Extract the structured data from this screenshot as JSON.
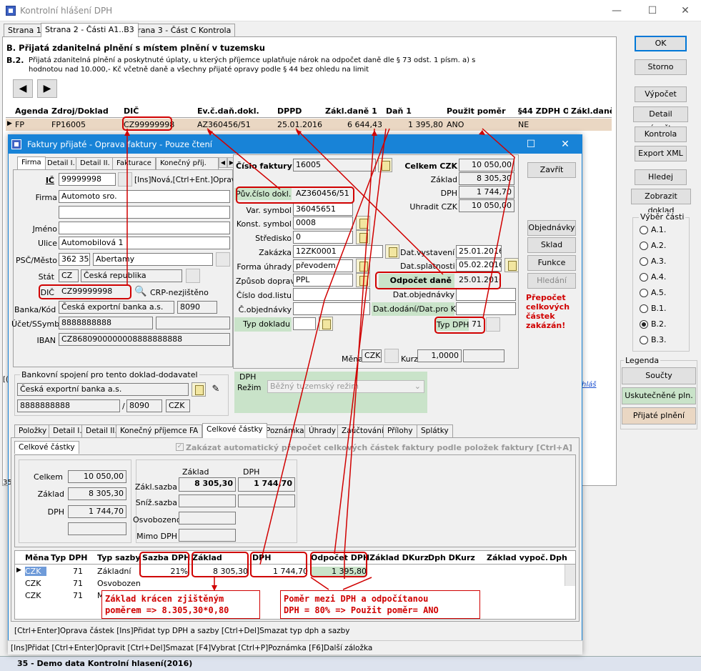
{
  "main_window": {
    "title": "Kontrolní hlášení DPH",
    "minimize": "—",
    "maximize": "☐",
    "close": "✕",
    "tabs": [
      "Strana 1",
      "Strana 2 - Části A1..B3",
      "Strana 3 - Část C Kontrola"
    ],
    "section_title": "B. Přijatá zdanitelná plnění s místem plnění v tuzemsku",
    "section_code": "B.2.",
    "section_desc1": "Přijatá zdanitelná plnění a poskytnuté úplaty, u kterých příjemce uplatňuje nárok na odpočet daně dle § 73 odst. 1 písm. a) s",
    "section_desc2": "hodnotou nad 10.000,- Kč včetně daně a všechny přijaté opravy podle § 44 bez ohledu na limit",
    "nav_prev": "◀",
    "nav_next": "▶",
    "grid": {
      "headers": [
        "Agenda",
        "Zdroj/Doklad",
        "DIČ",
        "Ev.č.daň.dokl.",
        "DPPD",
        "Zákl.daně 1",
        "Daň 1",
        "Použit poměr",
        "§44 ZDPH O",
        "Zákl.daně"
      ],
      "row": [
        "FP",
        "FP16005",
        "CZ99999998",
        "AZ360456/51",
        "25.01.2016",
        "6 644,43",
        "1 395,80",
        "ANO",
        "NE",
        ""
      ]
    },
    "buttons": [
      "OK",
      "Storno",
      "Výpočet",
      "Detail výpočtu",
      "Kontrola",
      "Export XML",
      "Hledej",
      "Zobrazit doklad"
    ],
    "vyber_title": "Výběr části",
    "parts": [
      "A.1.",
      "A.2.",
      "A.3.",
      "A.4.",
      "A.5.",
      "B.1.",
      "B.2.",
      "B.3."
    ],
    "selected_part": "B.2.",
    "legenda_title": "Legenda",
    "legenda": [
      "Součty",
      "Uskutečněné pln.",
      "Přijaté plnění"
    ],
    "legenda_colors": [
      "#ffffff",
      "#c9e3c9",
      "#ead7c3"
    ],
    "link_text": "hláš",
    "status": "35 - Demo data Kontrolní hlasení(2016)"
  },
  "dialog": {
    "title": "Faktury přijaté - Oprava faktury - Pouze čtení",
    "maximize": "☐",
    "close": "✕",
    "tabs": [
      "Firma",
      "Detail I.",
      "Detail II.",
      "Fakturace",
      "Konečný příj."
    ],
    "ic_label": "IČ",
    "ic": "99999998",
    "ic_hint": "[Ins]Nová,[Ctrl+Ent.]Oprava",
    "firma_label": "Firma",
    "firma": "Automoto sro.",
    "jmeno_label": "Jméno",
    "ulice_label": "Ulice",
    "ulice": "Automobilová 1",
    "psc_label": "PSČ/Město",
    "psc": "362 35",
    "mesto": "Abertamy",
    "stat_label": "Stát",
    "stat_code": "CZ",
    "stat": "Česká republika",
    "dic_label": "DIČ",
    "dic": "CZ99999998",
    "crp": "CRP-nezjištěno",
    "banka_label": "Banka/Kód",
    "banka": "Česká exportní banka a.s.",
    "kod": "8090",
    "ucet_label": "Účet/SSymb",
    "ucet": "8888888888",
    "iban_label": "IBAN",
    "iban": "CZ8680900000008888888888",
    "cislo_label": "Číslo faktury",
    "cislo": "16005",
    "puv_label": "Pův.číslo dokl.",
    "puv": "AZ360456/51",
    "var_label": "Var. symbol",
    "var": "36045651",
    "konst_label": "Konst. symbol",
    "konst": "0008",
    "stredisko_label": "Středisko",
    "stredisko": "0",
    "zakazka_label": "Zakázka",
    "zakazka": "12ZK0001",
    "forma_label": "Forma úhrady",
    "forma": "převodem",
    "zpusob_label": "Způsob dopravy",
    "zpusob": "PPL",
    "doddlist_label": "Číslo dod.listu",
    "objed_label": "Č.objednávky",
    "typdokl_label": "Typ dokladu",
    "celkem_czk_label": "Celkem CZK",
    "celkem_czk": "10 050,00",
    "zaklad_label": "Základ",
    "zaklad": "8 305,30",
    "dph_label": "DPH",
    "dph": "1 744,70",
    "uhradit_label": "Uhradit CZK",
    "uhradit": "10 050,00",
    "datvyst_label": "Dat.vystavení",
    "datvyst": "25.01.2016",
    "datspl_label": "Dat.splatnosti",
    "datspl": "05.02.2016",
    "odpocet_label": "Odpočet daně",
    "odpocet": "25.01.2016",
    "datobj_label": "Dat.objednávky",
    "datdod_label": "Dat.dodání/Dat.pro KH",
    "typdph_label": "Typ DPH",
    "typdph": "71",
    "mena_label": "Měna",
    "mena": "CZK",
    "kurz_label": "Kurz",
    "kurz": "1,0000",
    "buttons": [
      "Zavřít",
      "Objednávky",
      "Sklad",
      "Funkce",
      "Hledání"
    ],
    "prepocet_note": [
      "Přepočet",
      "celkových",
      "částek",
      "zakázán!"
    ],
    "bank_group_title": "Bankovní spojení pro tento doklad-dodavatel",
    "bank_name": "Česká exportní banka a.s.",
    "bank_acc": "8888888888",
    "bank_slash": "/",
    "bank_code": "8090",
    "bank_cur": "CZK",
    "dph_group": "DPH",
    "rezim_label": "Režim",
    "rezim": "Běžný tuzemský režim",
    "tabs2": [
      "Položky",
      "Detail I.",
      "Detail II.",
      "Konečný příjemce FA",
      "Celkové částky",
      "Poznámka",
      "Úhrady",
      "Zaúčtování",
      "Přílohy",
      "Splátky"
    ],
    "subtab": "Celkové částky",
    "zakazat_text": "Zakázat automatický přepočet celkových částek faktury podle položek faktury [Ctrl+A]",
    "tot_celkem_label": "Celkem",
    "tot_celkem": "10 050,00",
    "tot_zaklad_label": "Základ",
    "tot_zaklad": "8 305,30",
    "tot_dph_label": "DPH",
    "tot_dph": "1 744,70",
    "col_zaklad": "Základ",
    "col_dph": "DPH",
    "zakl_sazba_label": "Zákl.sazba",
    "zakl_sazba_zaklad": "8 305,30",
    "zakl_sazba_dph": "1 744,70",
    "sniz_label": "Sníž.sazba",
    "osvob_label": "Osvobozeno",
    "mimo_label": "Mimo DPH",
    "grid2": {
      "headers": [
        "Měna",
        "Typ DPH",
        "Typ sazby",
        "Sazba DPH",
        "Základ",
        "DPH",
        "Odpočet DPH",
        "Základ DKurz",
        "Dph DKurz",
        "Základ vypoč.",
        "Dph"
      ],
      "rows": [
        [
          "CZK",
          "71",
          "Základní",
          "21%",
          "8 305,30",
          "1 744,70",
          "1 395,80"
        ],
        [
          "CZK",
          "71",
          "Osvobozenc",
          "",
          "",
          "",
          ""
        ],
        [
          "CZK",
          "71",
          "M",
          "",
          "",
          "",
          ""
        ]
      ]
    },
    "hint_line": "[Ctrl+Enter]Oprava částek [Ins]Přidat typ DPH a sazby [Ctrl+Del]Smazat typ dph a sazby",
    "bottom_hint": "[Ins]Přidat [Ctrl+Enter]Opravit [Ctrl+Del]Smazat [F4]Vybrat [Ctrl+P]Poznámka [F6]Další záložka",
    "note1": [
      "Základ krácen zjištěným",
      "poměrem => 8.305,30*0,80"
    ],
    "note2": [
      "Poměr mezi DPH a odpočítanou",
      "DPH = 80% => Použit poměr= ANO"
    ],
    "side_num": "35",
    "side_bracket": "[("
  }
}
